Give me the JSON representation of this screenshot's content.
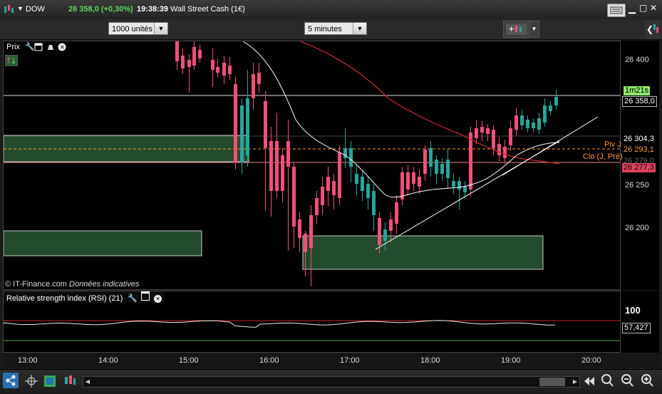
{
  "titlebar": {
    "symbol": "DOW",
    "price": "26 358,0 (+0,30%)",
    "time": "19:38:39",
    "instrument": "Wall Street Cash (1€)"
  },
  "toolbar": {
    "units": "1000 unités",
    "interval": "5 minutes"
  },
  "chart": {
    "panel_label": "Prix",
    "copyright": "© IT-Finance.com",
    "disclaimer": "Données indicatives",
    "y_ticks": [
      "26 400",
      "26 250",
      "26 200"
    ],
    "tags": {
      "timer": "1m21s",
      "last": "26 358,0",
      "level1": "26 304,3",
      "piv": "26 293,1",
      "piv_label": "Piv J",
      "clo": "26 279,0",
      "clo_label": "Clo (J, Pré)",
      "low": "26 277,3"
    },
    "colors": {
      "up": "#26a69a",
      "down": "#f0507a",
      "ma_fast": "#ffffff",
      "ma_slow": "#c0272d",
      "zone": "#234a2c",
      "pivot": "#ff9a3c"
    }
  },
  "rsi": {
    "title": "Relative strength index (RSI) (21)",
    "top_tick": "100",
    "value": "57,427"
  },
  "xaxis": [
    "13:00",
    "14:00",
    "15:00",
    "16:00",
    "17:00",
    "18:00",
    "19:00",
    "20:00"
  ]
}
